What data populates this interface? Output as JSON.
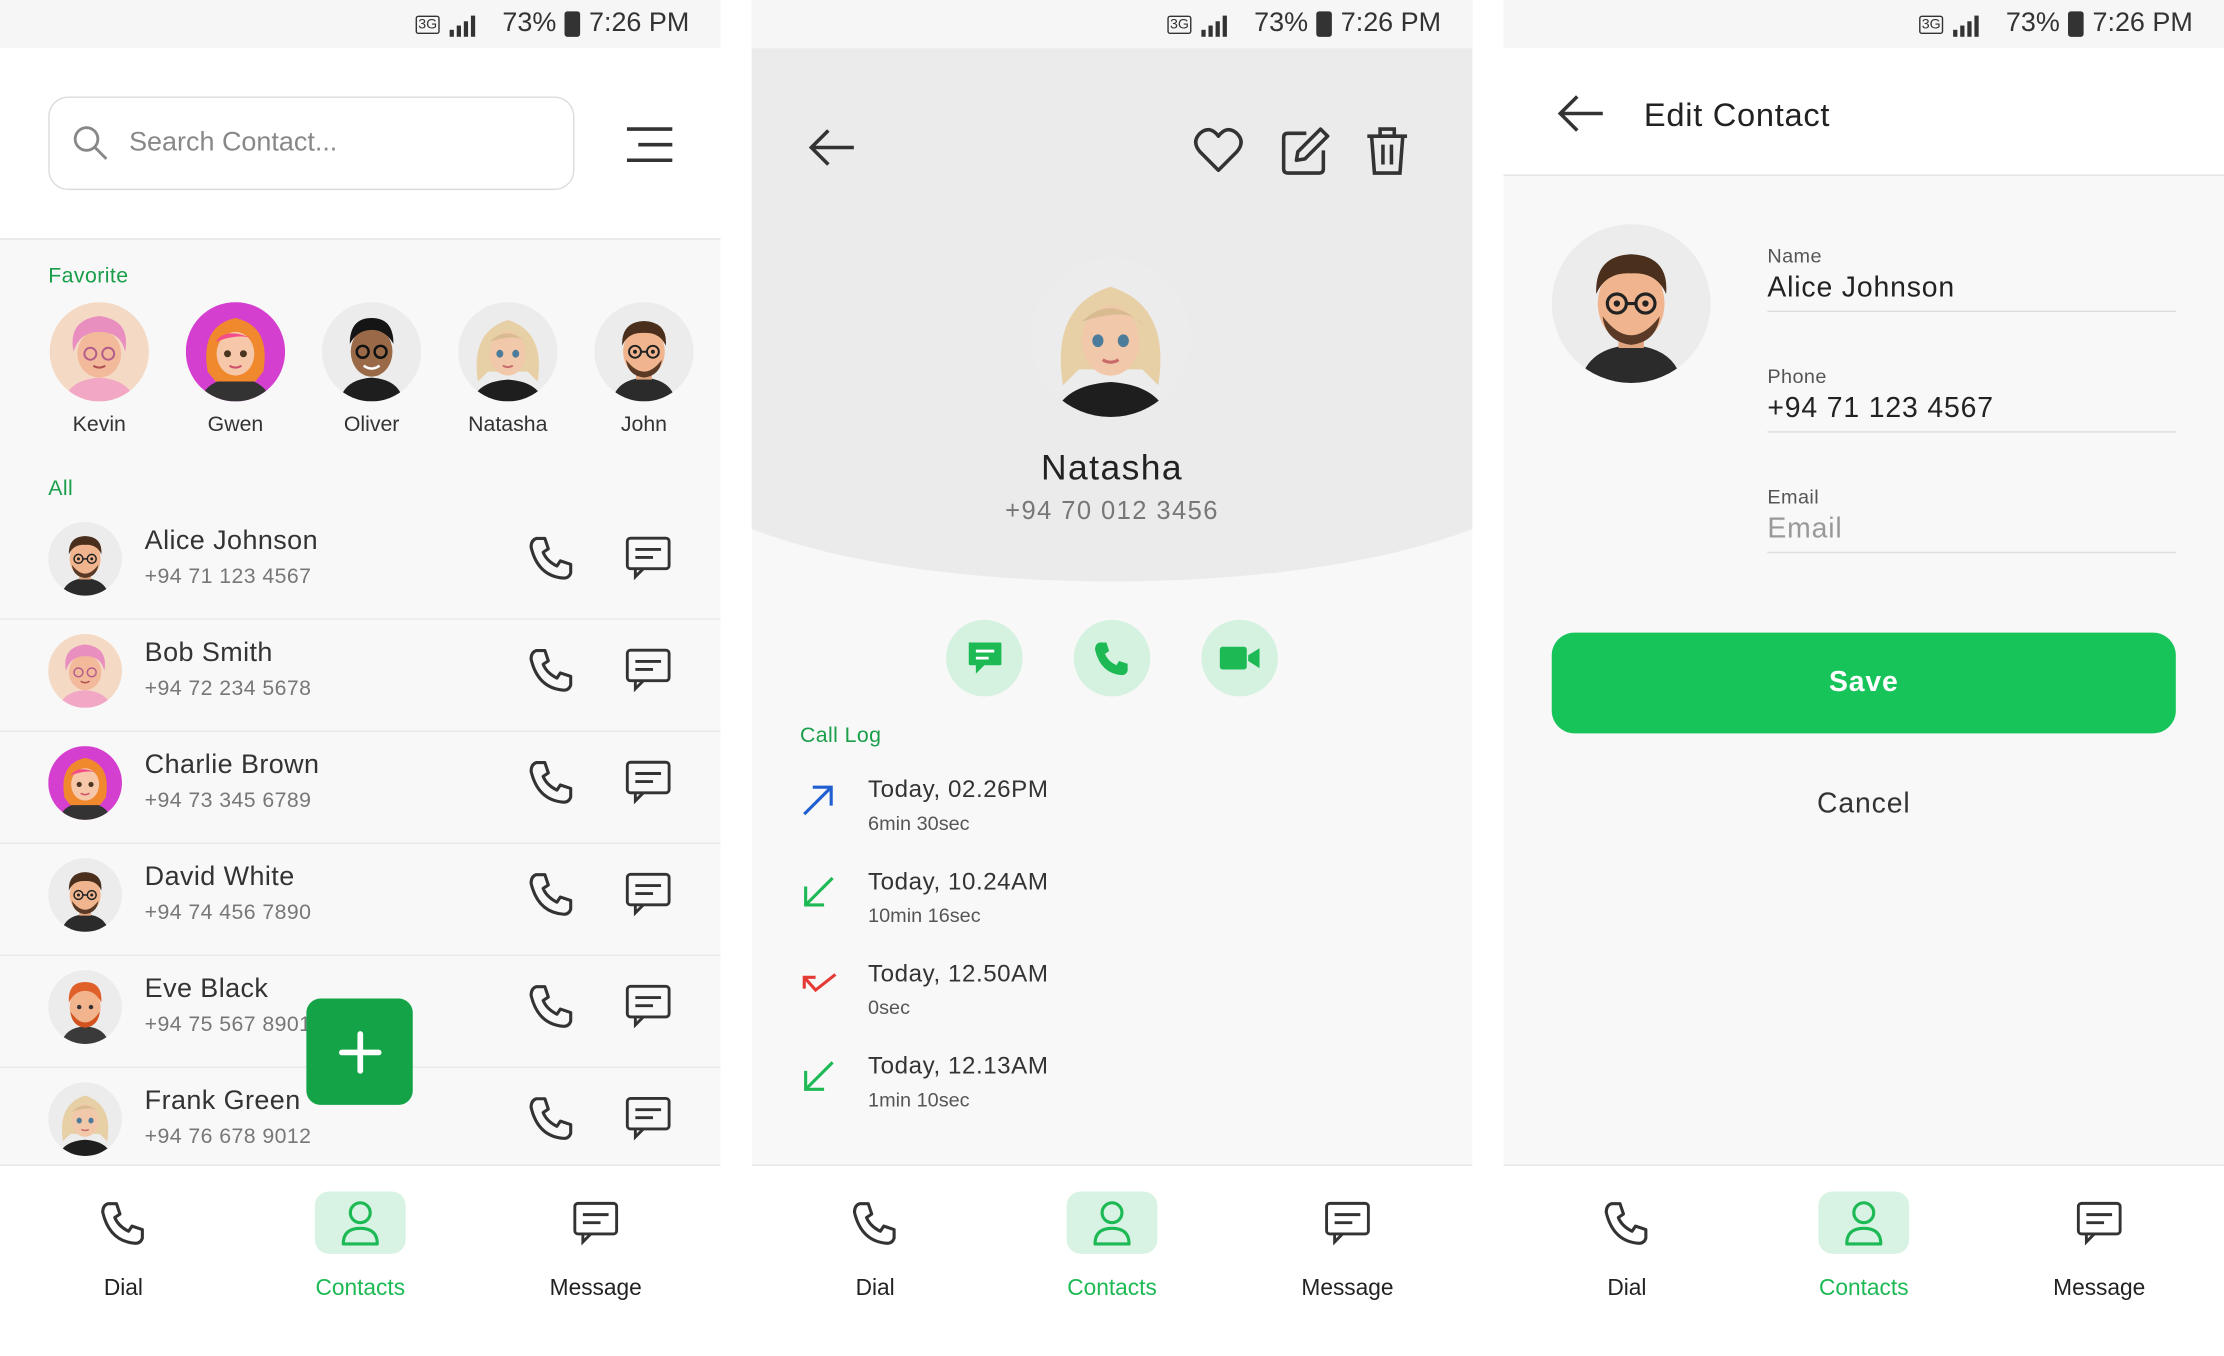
{
  "status_bar": {
    "network": "3G",
    "battery": "73%",
    "time": "7:26 PM"
  },
  "colors": {
    "accent": "#1db954",
    "fab": "#14a447",
    "save": "#16c45a",
    "outgoing": "#1f5fd0",
    "incoming": "#1db954",
    "missed": "#e53935"
  },
  "contacts_screen": {
    "search_placeholder": "Search Contact...",
    "favorite_label": "Favorite",
    "favorites": [
      {
        "name": "Kevin"
      },
      {
        "name": "Gwen"
      },
      {
        "name": "Oliver"
      },
      {
        "name": "Natasha"
      },
      {
        "name": "John"
      }
    ],
    "all_label": "All",
    "contacts": [
      {
        "name": "Alice Johnson",
        "phone": "+94 71 123 4567"
      },
      {
        "name": "Bob Smith",
        "phone": "+94 72 234 5678"
      },
      {
        "name": "Charlie Brown",
        "phone": "+94 73 345 6789"
      },
      {
        "name": "David White",
        "phone": "+94 74 456 7890"
      },
      {
        "name": "Eve Black",
        "phone": "+94 75 567 8901"
      },
      {
        "name": "Frank Green",
        "phone": "+94 76 678 9012"
      }
    ]
  },
  "detail_screen": {
    "name": "Natasha",
    "phone": "+94 70 012 3456",
    "call_log_label": "Call Log",
    "call_log": [
      {
        "type": "outgoing",
        "time": "Today, 02.26PM",
        "duration": "6min 30sec"
      },
      {
        "type": "incoming",
        "time": "Today, 10.24AM",
        "duration": "10min 16sec"
      },
      {
        "type": "missed",
        "time": "Today, 12.50AM",
        "duration": "0sec"
      },
      {
        "type": "incoming",
        "time": "Today, 12.13AM",
        "duration": "1min 10sec"
      }
    ]
  },
  "edit_screen": {
    "title": "Edit Contact",
    "name_label": "Name",
    "name_value": "Alice Johnson",
    "phone_label": "Phone",
    "phone_value": "+94 71 123 4567",
    "email_label": "Email",
    "email_value": "",
    "email_placeholder": "Email",
    "save_label": "Save",
    "cancel_label": "Cancel"
  },
  "nav": {
    "dial": "Dial",
    "contacts": "Contacts",
    "message": "Message",
    "active": "contacts"
  }
}
